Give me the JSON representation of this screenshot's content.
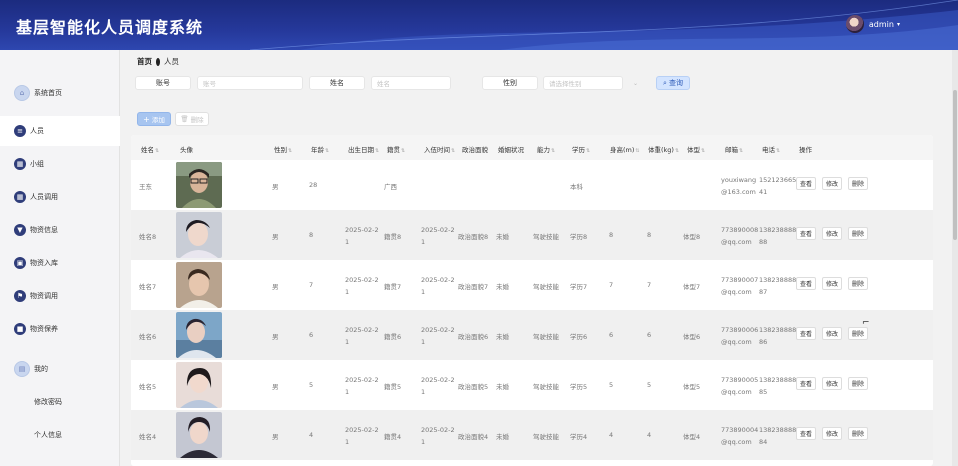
{
  "header": {
    "title": "基层智能化人员调度系统",
    "username": "admin"
  },
  "sidebar": {
    "items": [
      {
        "label": "系统首页",
        "icon": "home-icon"
      },
      {
        "label": "人员",
        "icon": "menu-icon"
      },
      {
        "label": "小组",
        "icon": "grid-icon"
      },
      {
        "label": "人员调用",
        "icon": "grid-icon"
      },
      {
        "label": "物资信息",
        "icon": "cup-icon"
      },
      {
        "label": "物资入库",
        "icon": "box-icon"
      },
      {
        "label": "物资调用",
        "icon": "flag-icon"
      },
      {
        "label": "物资保养",
        "icon": "briefcase-icon"
      },
      {
        "label": "我的",
        "icon": "user-card-icon"
      }
    ],
    "sub_items": [
      "修改密码",
      "个人信息"
    ]
  },
  "breadcrumb": {
    "home": "首页",
    "current": "人员"
  },
  "filters": {
    "account_label": "账号",
    "account_placeholder": "账号",
    "name_label": "姓名",
    "name_placeholder": "姓名",
    "gender_label": "性别",
    "gender_placeholder": "请选择性别",
    "search_label": "查询"
  },
  "actions": {
    "add_label": "添加",
    "delete_label": "删除"
  },
  "table": {
    "headers": [
      "姓名",
      "头像",
      "性别",
      "年龄",
      "出生日期",
      "籍贯",
      "入伍时间",
      "政治面貌",
      "婚姻状况",
      "能力",
      "学历",
      "身高(m)",
      "体重(kg)",
      "体型",
      "邮箱",
      "电话",
      "操作"
    ],
    "row_actions": {
      "view": "查看",
      "edit": "修改",
      "delete": "删除"
    },
    "rows": [
      {
        "name": "王东",
        "gender": "男",
        "age": "28",
        "birth": "",
        "origin": "广西",
        "enlist": "",
        "political": "",
        "marital": "",
        "ability": "",
        "education": "本科",
        "height": "",
        "weight": "",
        "body": "",
        "email1": "youxiwang",
        "email2": "@163.com",
        "phone1": "152123665",
        "phone2": "41"
      },
      {
        "name": "姓名8",
        "gender": "男",
        "age": "8",
        "birth1": "2025-02-2",
        "birth2": "1",
        "origin": "籍贯8",
        "enlist1": "2025-02-2",
        "enlist2": "1",
        "political": "政治面貌8",
        "marital": "未婚",
        "ability": "驾驶技能",
        "education": "学历8",
        "height": "8",
        "weight": "8",
        "body": "体型8",
        "email1": "773890008",
        "email2": "@qq.com",
        "phone1": "138238888",
        "phone2": "88"
      },
      {
        "name": "姓名7",
        "gender": "男",
        "age": "7",
        "birth1": "2025-02-2",
        "birth2": "1",
        "origin": "籍贯7",
        "enlist1": "2025-02-2",
        "enlist2": "1",
        "political": "政治面貌7",
        "marital": "未婚",
        "ability": "驾驶技能",
        "education": "学历7",
        "height": "7",
        "weight": "7",
        "body": "体型7",
        "email1": "773890007",
        "email2": "@qq.com",
        "phone1": "138238888",
        "phone2": "87"
      },
      {
        "name": "姓名6",
        "gender": "男",
        "age": "6",
        "birth1": "2025-02-2",
        "birth2": "1",
        "origin": "籍贯6",
        "enlist1": "2025-02-2",
        "enlist2": "1",
        "political": "政治面貌6",
        "marital": "未婚",
        "ability": "驾驶技能",
        "education": "学历6",
        "height": "6",
        "weight": "6",
        "body": "体型6",
        "email1": "773890006",
        "email2": "@qq.com",
        "phone1": "138238888",
        "phone2": "86"
      },
      {
        "name": "姓名5",
        "gender": "男",
        "age": "5",
        "birth1": "2025-02-2",
        "birth2": "1",
        "origin": "籍贯5",
        "enlist1": "2025-02-2",
        "enlist2": "1",
        "political": "政治面貌5",
        "marital": "未婚",
        "ability": "驾驶技能",
        "education": "学历5",
        "height": "5",
        "weight": "5",
        "body": "体型5",
        "email1": "773890005",
        "email2": "@qq.com",
        "phone1": "138238888",
        "phone2": "85"
      },
      {
        "name": "姓名4",
        "gender": "男",
        "age": "4",
        "birth1": "2025-02-2",
        "birth2": "1",
        "origin": "籍贯4",
        "enlist1": "2025-02-2",
        "enlist2": "1",
        "political": "政治面貌4",
        "marital": "未婚",
        "ability": "驾驶技能",
        "education": "学历4",
        "height": "4",
        "weight": "4",
        "body": "体型4",
        "email1": "773890004",
        "email2": "@qq.com",
        "phone1": "138238888",
        "phone2": "84"
      }
    ]
  }
}
